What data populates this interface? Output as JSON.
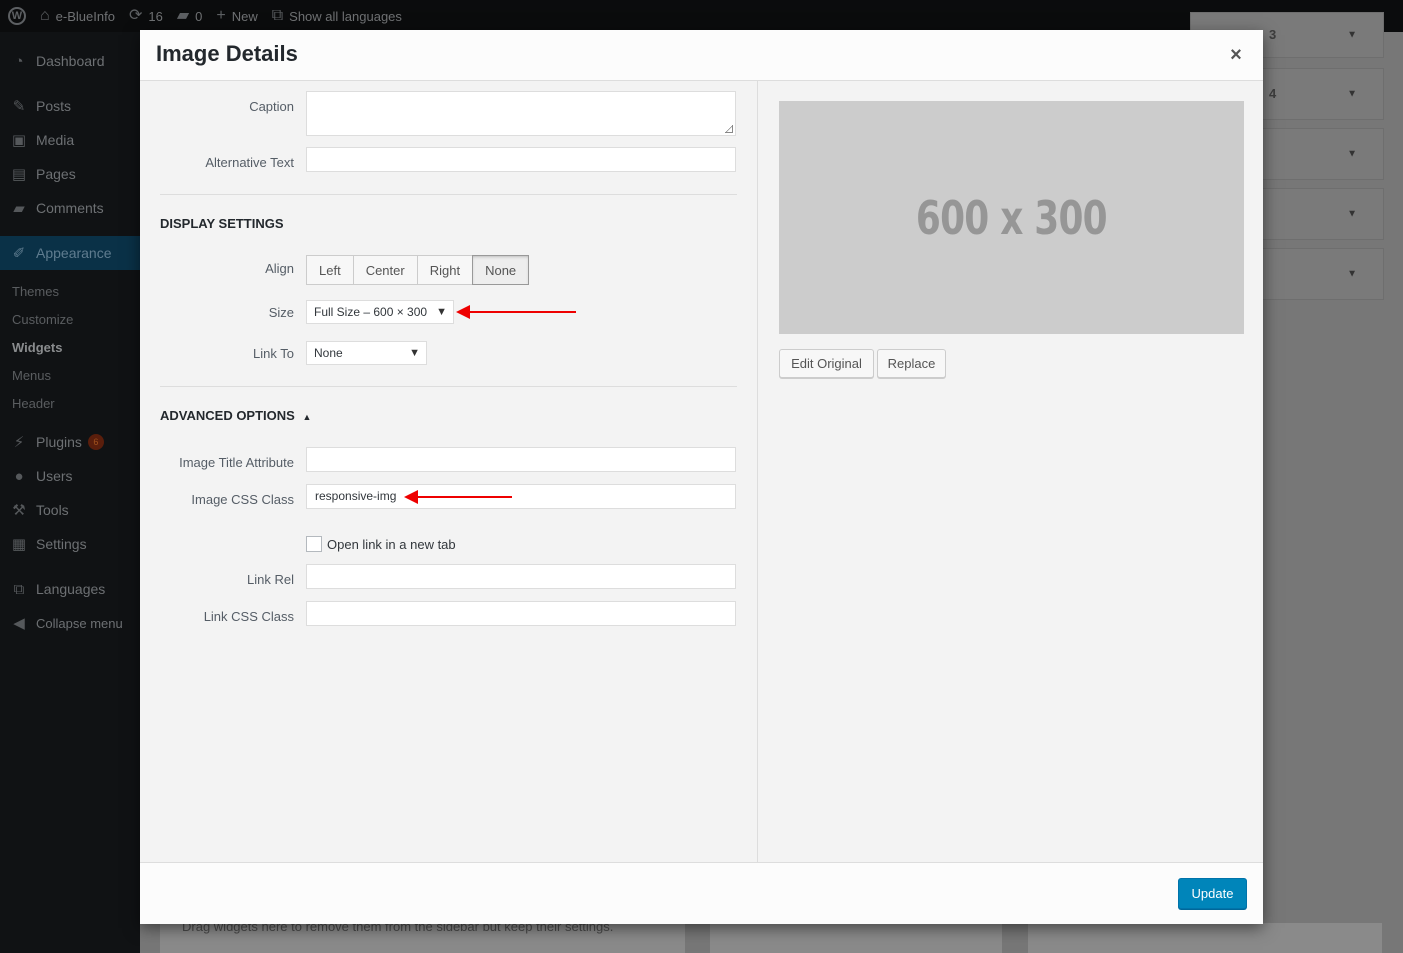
{
  "admin_bar": {
    "site_name": "e-BlueInfo",
    "updates_count": "16",
    "comments_count": "0",
    "new_label": "New",
    "languages_label": "Show all languages"
  },
  "sidebar": {
    "dashboard": "Dashboard",
    "posts": "Posts",
    "media": "Media",
    "pages": "Pages",
    "comments": "Comments",
    "appearance": "Appearance",
    "submenu": {
      "themes": "Themes",
      "customize": "Customize",
      "widgets": "Widgets",
      "menus": "Menus",
      "header": "Header"
    },
    "plugins": "Plugins",
    "plugins_badge": "6",
    "users": "Users",
    "tools": "Tools",
    "settings": "Settings",
    "languages": "Languages",
    "collapse": "Collapse menu"
  },
  "background": {
    "widget_labels": [
      "3",
      "4"
    ],
    "drag_hint": "Drag widgets here to remove them from the sidebar but keep their settings."
  },
  "modal": {
    "title": "Image Details",
    "close_symbol": "×",
    "fields": {
      "caption_label": "Caption",
      "caption_value": "",
      "alt_label": "Alternative Text",
      "alt_value": ""
    },
    "display_settings": {
      "title": "DISPLAY SETTINGS",
      "align_label": "Align",
      "align_options": [
        "Left",
        "Center",
        "Right",
        "None"
      ],
      "align_selected": "None",
      "size_label": "Size",
      "size_value": "Full Size – 600 × 300",
      "link_to_label": "Link To",
      "link_to_value": "None"
    },
    "advanced": {
      "title": "ADVANCED OPTIONS",
      "toggle_symbol": "▲",
      "title_attr_label": "Image Title Attribute",
      "title_attr_value": "",
      "css_class_label": "Image CSS Class",
      "css_class_value": "responsive-img",
      "new_tab_label": "Open link in a new tab",
      "new_tab_checked": false,
      "link_rel_label": "Link Rel",
      "link_rel_value": "",
      "link_css_label": "Link CSS Class",
      "link_css_value": ""
    },
    "preview": {
      "placeholder_text": "600 x 300",
      "edit_original_label": "Edit Original",
      "replace_label": "Replace"
    },
    "footer": {
      "update_label": "Update"
    }
  },
  "colors": {
    "accent": "#0085ba",
    "annotation_arrow": "#ee0000",
    "admin_bar": "#0b0c0d",
    "sidebar": "#101214"
  }
}
